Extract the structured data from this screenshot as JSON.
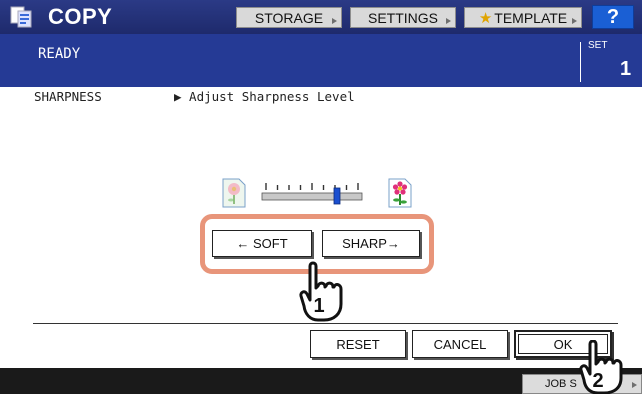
{
  "header": {
    "app_title": "COPY",
    "app_icon": "copy-icon",
    "buttons": {
      "storage": "STORAGE",
      "settings": "SETTINGS",
      "template": "TEMPLATE",
      "help": "?"
    }
  },
  "status": {
    "message": "READY",
    "set_label": "SET",
    "set_count": "1"
  },
  "content": {
    "function_name": "SHARPNESS",
    "description": "▶ Adjust Sharpness Level",
    "slider_level_fraction": 0.75,
    "soft_label": "← SOFT",
    "sharp_label": "SHARP→",
    "callout_step_1": "1"
  },
  "actions": {
    "reset": "RESET",
    "cancel": "CANCEL",
    "ok": "OK",
    "callout_step_2": "2"
  },
  "footer": {
    "job_status": "JOB S"
  },
  "colors": {
    "header_bg": "#1e2a6c",
    "status_bg": "#253a95",
    "help_button": "#1a5fd4",
    "callout_border": "#e8957a",
    "slider_marker": "#1a4fd0"
  }
}
